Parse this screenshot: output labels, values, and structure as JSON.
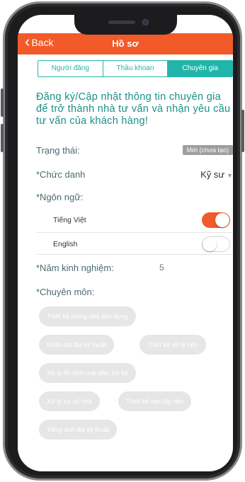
{
  "header": {
    "back_label": "Back",
    "title": "Hồ sơ"
  },
  "tabs": [
    {
      "label": "Người đăng",
      "active": false
    },
    {
      "label": "Thầu khoan",
      "active": false
    },
    {
      "label": "Chuyên gia",
      "active": true
    }
  ],
  "intro": "Đăng ký/Cập nhật thông tin chuyên gia để trở thành nhà tư vấn và nhận yêu cầu tư vấn của khách hàng!",
  "status": {
    "label": "Trạng thái:",
    "badge": "Mới (chưa tạo)"
  },
  "title_field": {
    "label": "*Chức danh",
    "value": "Kỹ sư"
  },
  "languages": {
    "label": "*Ngôn ngữ:",
    "items": [
      {
        "label": "Tiếng Việt",
        "enabled": true
      },
      {
        "label": "English",
        "enabled": false
      }
    ]
  },
  "experience": {
    "label": "*Năm kinh nghiệm:",
    "value": "5"
  },
  "specialties": {
    "label": "*Chuyên môn:",
    "chips": [
      "Thiết kế móng nhà dân dụng",
      "Khảo sát địa kỹ thuật",
      "Thiết kế xử lý nền",
      "Xử lý ổn định mái dốc, bờ kè",
      "Xử lý sự cố nhà",
      "Thiết kế san lấp nền",
      "Tiếng anh địa kỹ thuật"
    ]
  },
  "colors": {
    "accent": "#f25a2a",
    "teal": "#22b5a9",
    "chip_bg": "#e6e6e6"
  }
}
